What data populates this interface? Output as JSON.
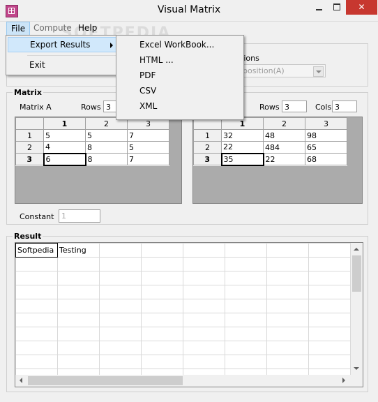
{
  "window": {
    "title": "Visual Matrix",
    "close_glyph": "✕",
    "watermark": "SOFTPEDIA"
  },
  "menubar": {
    "file": "File",
    "compute": "Compute",
    "help": "Help"
  },
  "file_menu": {
    "export_results": "Export Results",
    "exit": "Exit"
  },
  "export_submenu": [
    "Excel WorkBook...",
    "HTML ...",
    "PDF",
    "CSV",
    "XML"
  ],
  "operations": {
    "label_partial": "tions",
    "selected_partial": "position(A)"
  },
  "matrix": {
    "group_label": "Matrix",
    "matrix_a_label": "Matrix A",
    "rows_label": "Rows",
    "rows_a_value": "3",
    "rows_b_value": "3",
    "cols_label": "Cols",
    "cols_b_value": "3",
    "constant_label": "Constant",
    "constant_value": "1"
  },
  "matrix_a": {
    "col_headers": [
      "1",
      "2",
      "3"
    ],
    "rows": [
      {
        "header": "1",
        "cells": [
          "5",
          "5",
          "7"
        ]
      },
      {
        "header": "2",
        "cells": [
          "4",
          "8",
          "5"
        ]
      },
      {
        "header": "3",
        "cells": [
          "6",
          "8",
          "7"
        ]
      }
    ]
  },
  "matrix_b": {
    "col_headers": [
      "1",
      "2",
      "3"
    ],
    "rows": [
      {
        "header": "1",
        "cells": [
          "32",
          "48",
          "98"
        ]
      },
      {
        "header": "2",
        "cells": [
          "22",
          "484",
          "65"
        ]
      },
      {
        "header": "3",
        "cells": [
          "35",
          "22",
          "68"
        ]
      }
    ]
  },
  "result": {
    "group_label": "Result",
    "cell_1_1": "Softpedia",
    "cell_1_2": "Testing"
  },
  "colors": {
    "close_button": "#c7372f",
    "menu_highlight": "#cce4f7",
    "grid_empty": "#ababab"
  }
}
